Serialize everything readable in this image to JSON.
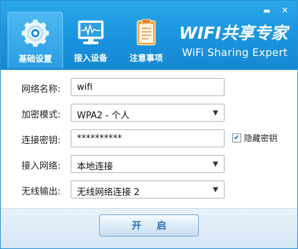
{
  "window": {
    "minimize_glyph": "▬",
    "close_glyph": "✕"
  },
  "tabs": [
    {
      "label": "基础设置",
      "icon": "gear-icon",
      "active": true
    },
    {
      "label": "接入设备",
      "icon": "monitor-icon",
      "active": false
    },
    {
      "label": "注意事项",
      "icon": "notepad-icon",
      "active": false
    }
  ],
  "brand": {
    "title": "WIFI共享专家",
    "subtitle": "WiFi Sharing Expert"
  },
  "form": {
    "network_name": {
      "label": "网络名称:",
      "value": "wifi"
    },
    "encryption": {
      "label": "加密模式:",
      "value": "WPA2 - 个人"
    },
    "password": {
      "label": "连接密钥:",
      "value": "**********"
    },
    "hide_key": {
      "label": "隐藏密钥",
      "checked": true
    },
    "access_network": {
      "label": "接入网络:",
      "value": "本地连接"
    },
    "wireless_output": {
      "label": "无线输出:",
      "value": "无线网络连接 2"
    }
  },
  "footer": {
    "start_label": "开启"
  },
  "colors": {
    "header_blue": "#1a93dc",
    "button_text": "#2c6fb3"
  }
}
